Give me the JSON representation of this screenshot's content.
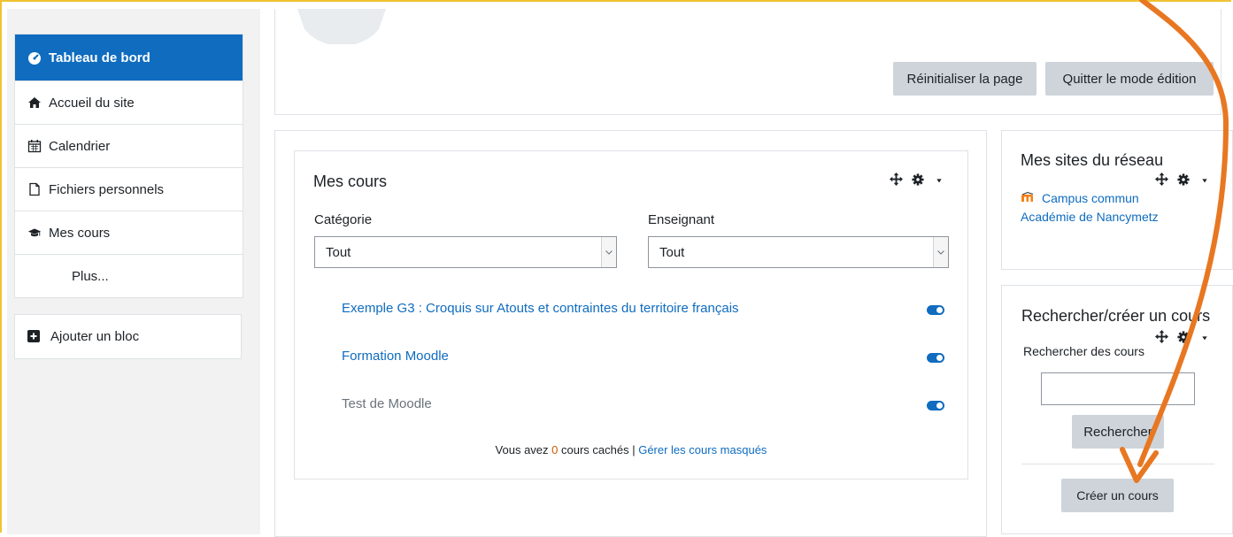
{
  "nav": {
    "items": [
      {
        "label": "Tableau de bord",
        "icon": "dashboard-icon",
        "active": true
      },
      {
        "label": "Accueil du site",
        "icon": "home-icon"
      },
      {
        "label": "Calendrier",
        "icon": "calendar-icon"
      },
      {
        "label": "Fichiers personnels",
        "icon": "file-icon"
      },
      {
        "label": "Mes cours",
        "icon": "graduation-cap-icon"
      },
      {
        "label": "Plus..."
      }
    ],
    "add_block": "Ajouter un bloc"
  },
  "header": {
    "reset_label": "Réinitialiser la page",
    "quit_edit_label": "Quitter le mode édition"
  },
  "my_courses": {
    "title": "Mes cours",
    "category_label": "Catégorie",
    "category_value": "Tout",
    "teacher_label": "Enseignant",
    "teacher_value": "Tout",
    "courses": [
      {
        "name": "Exemple G3 : Croquis sur Atouts et contraintes du territoire français",
        "visible": true
      },
      {
        "name": "Formation Moodle",
        "visible": true
      },
      {
        "name": "Test de Moodle",
        "visible": false
      }
    ],
    "hidden_prefix": "Vous avez ",
    "hidden_count": "0",
    "hidden_suffix": " cours cachés | ",
    "manage_hidden": "Gérer les cours masqués"
  },
  "network": {
    "title": "Mes sites du réseau",
    "link": "Campus commun Académie de Nancymetz"
  },
  "search_block": {
    "title": "Rechercher/créer un cours",
    "search_label": "Rechercher des cours",
    "search_value": "",
    "search_button": "Rechercher",
    "create_button": "Créer un cours"
  },
  "colors": {
    "accent": "#0f6cbf",
    "annotation_arrow": "#e87722",
    "frame": "#f0c330"
  }
}
